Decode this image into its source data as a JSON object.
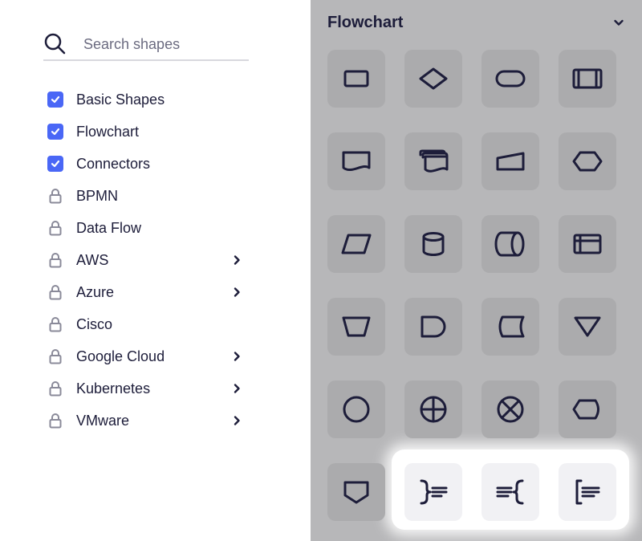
{
  "search": {
    "placeholder": "Search shapes",
    "value": ""
  },
  "categories": [
    {
      "label": "Basic Shapes",
      "state": "checked"
    },
    {
      "label": "Flowchart",
      "state": "checked"
    },
    {
      "label": "Connectors",
      "state": "checked"
    },
    {
      "label": "BPMN",
      "state": "locked"
    },
    {
      "label": "Data Flow",
      "state": "locked"
    },
    {
      "label": "AWS",
      "state": "locked",
      "has_submenu": true
    },
    {
      "label": "Azure",
      "state": "locked",
      "has_submenu": true
    },
    {
      "label": "Cisco",
      "state": "locked"
    },
    {
      "label": "Google Cloud",
      "state": "locked",
      "has_submenu": true
    },
    {
      "label": "Kubernetes",
      "state": "locked",
      "has_submenu": true
    },
    {
      "label": "VMware",
      "state": "locked",
      "has_submenu": true
    }
  ],
  "section": {
    "title": "Flowchart",
    "expanded": true
  },
  "shapes": [
    "process",
    "decision",
    "terminator",
    "predefined-process",
    "document",
    "multi-document",
    "manual-input",
    "preparation",
    "data",
    "database",
    "direct-access-storage",
    "internal-storage",
    "manual-operation",
    "delay",
    "stored-data",
    "merge",
    "connector",
    "summing-junction",
    "or",
    "display",
    "off-page-connector",
    "annotation-right",
    "annotation-left",
    "annotation-bracket"
  ],
  "highlighted_shapes": [
    "annotation-right",
    "annotation-left",
    "annotation-bracket"
  ],
  "colors": {
    "accent": "#4a67f6",
    "text": "#1d1d3a",
    "lock": "#8a8a99",
    "overlay": "#b7b7b9",
    "tile": "#ababad",
    "tile_highlight": "#f1f1f4"
  }
}
